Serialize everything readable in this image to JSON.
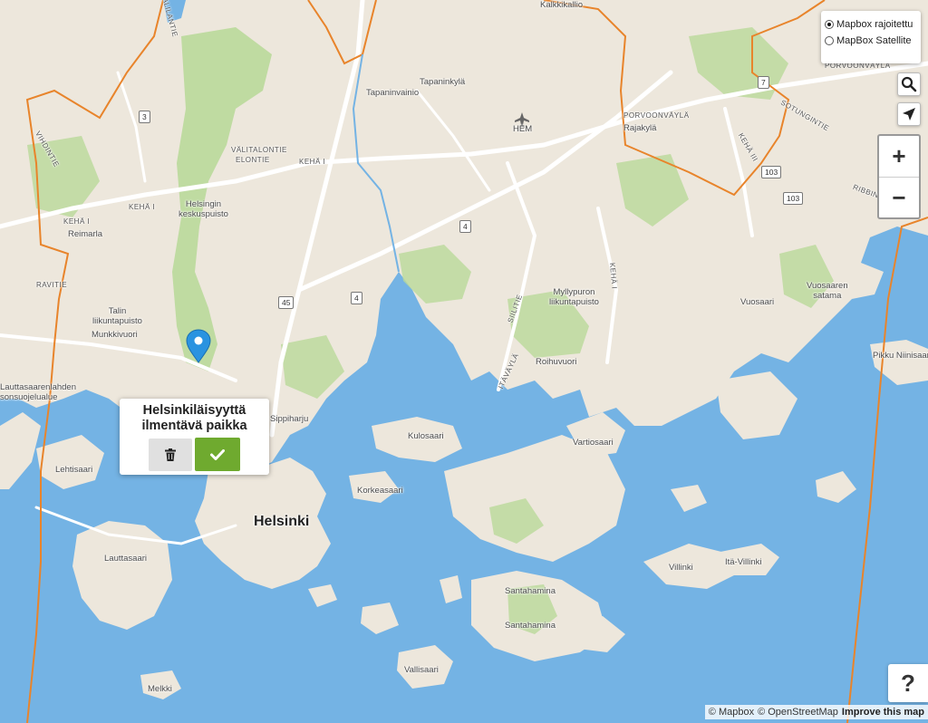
{
  "layers": {
    "options": [
      {
        "label": "Mapbox rajoitettu",
        "checked": true
      },
      {
        "label": "MapBox Satellite",
        "checked": false
      }
    ]
  },
  "controls": {
    "search_icon": "search-icon",
    "locate_icon": "locate-arrow-icon",
    "zoom_in": "+",
    "zoom_out": "−",
    "help": "?"
  },
  "popup": {
    "title": "Helsinkiläisyyttä\nilmentävä paikka",
    "delete_icon": "trash-icon",
    "confirm_icon": "check-icon",
    "confirm_color": "#6faa2f"
  },
  "attribution": {
    "mapbox": "© Mapbox",
    "osm": "© OpenStreetMap",
    "improve": "Improve this map"
  },
  "colors": {
    "water": "#74b3e4",
    "land": "#ede7dc",
    "park": "#b9d99a",
    "boundary": "#e8842b",
    "marker": "#2a93e0"
  },
  "places": {
    "kalkkikallio": "Kalkkikallio",
    "tapaninkyla": "Tapaninkylä",
    "tapaninvainio": "Tapaninvainio",
    "hem": "HEM",
    "rajakyla": "Rajakylä",
    "helsingin_keskuspuisto": "Helsingin\nkeskuspuisto",
    "reimarla": "Reimarla",
    "talin_liikuntapuisto": "Talin\nliikuntapuisto",
    "munkkivuori": "Munkkivuori",
    "myllypuron_liikuntapuisto": "Myllypuron\nliikuntapuisto",
    "vuosaari": "Vuosaari",
    "vuosaaren_satama": "Vuosaaren\nsatama",
    "roihuvuori": "Roihuvuori",
    "pikku_niinisaari": "Pikku Niinisaari",
    "lauttasaarenlahden": "Lauttasaarenlahden\nsonsuojelualue",
    "sorkkaharju": "Sippiharju",
    "kulosaari": "Kulosaari",
    "vartiosaari": "Vartiosaari",
    "lehtisaari": "Lehtisaari",
    "korkeasaari": "Korkeasaari",
    "helsinki": "Helsinki",
    "lauttasaari": "Lauttasaari",
    "villinki": "Villinki",
    "ita_villinki": "Itä-Villinki",
    "santahamina1": "Santahamina",
    "santahamina2": "Santahamina",
    "vallisaari": "Vallisaari",
    "melkki": "Melkki"
  },
  "roads": {
    "valitalontie": "VÄLITALONTIE",
    "elontie": "ELONTIE",
    "keha1a": "KEHÄ I",
    "keha1b": "KEHÄ I",
    "keha1c": "KEHÄ I",
    "keha1d": "KEHÄ I",
    "porvoonvayla1": "PORVOONVÄYLÄ",
    "porvoonvayla2": "PORVOONVÄYLÄ",
    "sotunginti": "SOTUNGINTIE",
    "keha3": "KEHÄ III",
    "vihdintie": "VIHDINTIE",
    "siilitie": "SIILITIE",
    "itavayla": "ITÄVÄYLÄ",
    "ravitie": "RAVITIE",
    "valilantie": "VALILANTIE",
    "ribbingen": "RIBBINGEN"
  },
  "shields": {
    "s3": "3",
    "s4a": "4",
    "s4b": "4",
    "s45": "45",
    "s7": "7",
    "s103a": "103",
    "s103b": "103"
  }
}
